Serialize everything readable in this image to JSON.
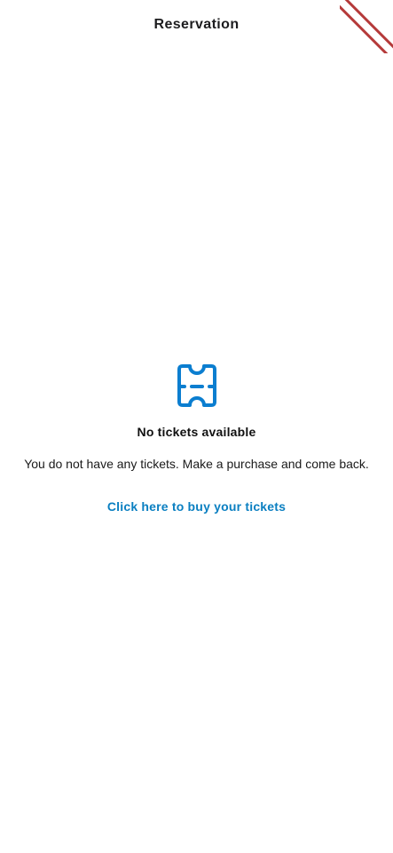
{
  "header": {
    "title": "Reservation"
  },
  "empty_state": {
    "icon": "ticket-icon",
    "title": "No tickets available",
    "message": "You do not have any tickets. Make a purchase and come back.",
    "buy_link": "Click here to buy your tickets"
  },
  "colors": {
    "accent": "#0a7fc1",
    "icon": "#0b7ed0",
    "ribbon": "#b53a3a"
  }
}
